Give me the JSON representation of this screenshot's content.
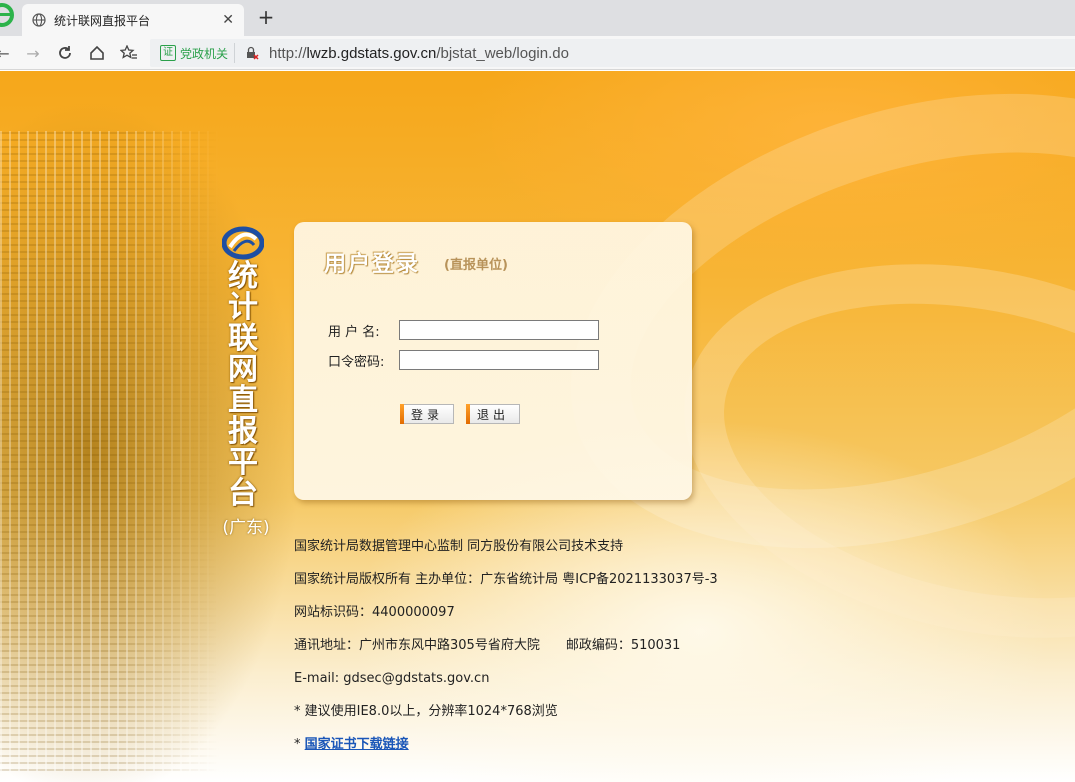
{
  "browser": {
    "tab_title": "统计联网直报平台",
    "address": {
      "badge": "党政机关",
      "badge_icon": "证",
      "url_prefix": "http://",
      "url_host": "lwzb.gdstats.gov.cn",
      "url_path": "/bjstat_web/login.do"
    }
  },
  "site": {
    "vertical_title": [
      "统",
      "计",
      "联",
      "网",
      "直",
      "报",
      "平",
      "台"
    ],
    "region": "(广东)"
  },
  "login": {
    "title": "用户登录",
    "subtitle": "(直报单位)",
    "username_label": "用 户 名:",
    "password_label": "口令密码:",
    "username_value": "",
    "password_value": "",
    "login_button": "登录",
    "exit_button": "退出"
  },
  "footer": {
    "line1": "国家统计局数据管理中心监制 同方股份有限公司技术支持",
    "line2": "国家统计局版权所有 主办单位：广东省统计局 粤ICP备2021133037号-3",
    "line3": "网站标识码：4400000097",
    "line4": "通讯地址：广州市东风中路305号省府大院　　邮政编码：510031",
    "line5": "E-mail: gdsec@gdstats.gov.cn",
    "line6": "* 建议使用IE8.0以上，分辨率1024*768浏览",
    "line7_prefix": "* ",
    "line7_link": "国家证书下载链接"
  }
}
